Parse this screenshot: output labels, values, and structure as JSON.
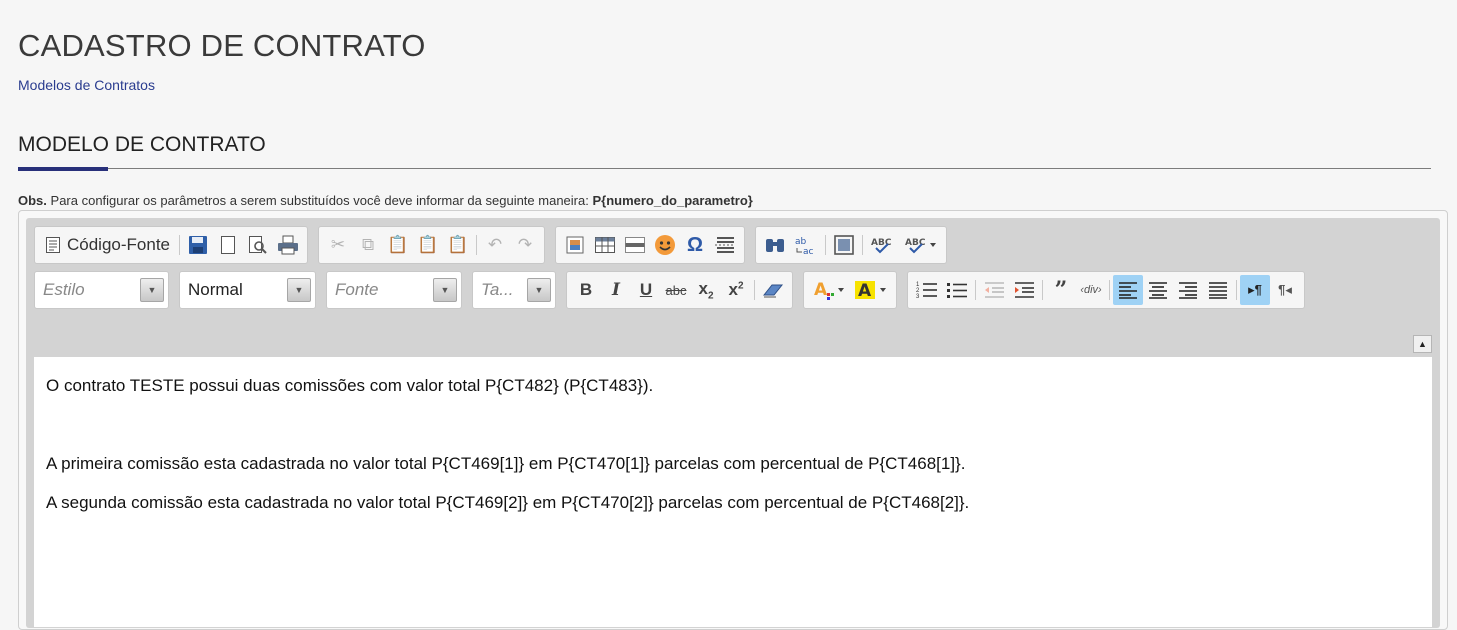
{
  "page": {
    "title": "CADASTRO DE CONTRATO",
    "breadcrumb": "Modelos de Contratos",
    "section_title": "MODELO DE CONTRATO"
  },
  "obs": {
    "label": "Obs.",
    "text": " Para configurar os parâmetros a serem substituídos você deve informar da seguinte maneira: ",
    "format": "P{numero_do_parametro}"
  },
  "toolbar": {
    "source_label": "Código-Fonte",
    "style_placeholder": "Estilo",
    "format_value": "Normal",
    "font_placeholder": "Fonte",
    "size_placeholder": "Ta..."
  },
  "content": {
    "paragraphs": [
      "O contrato TESTE possui duas comissões com valor total P{CT482} (P{CT483}).",
      "A primeira comissão esta cadastrada no valor total P{CT469[1]} em P{CT470[1]} parcelas com percentual de P{CT468[1]}.",
      "A segunda comissão esta cadastrada no valor total P{CT469[2]} em P{CT470[2]} parcelas com percentual de P{CT468[2]}."
    ]
  },
  "colors": {
    "accent": "#28307a",
    "link": "#2a3c8f",
    "active_button": "#9fd2f5",
    "toolbar_bg": "#d3d3d3"
  }
}
